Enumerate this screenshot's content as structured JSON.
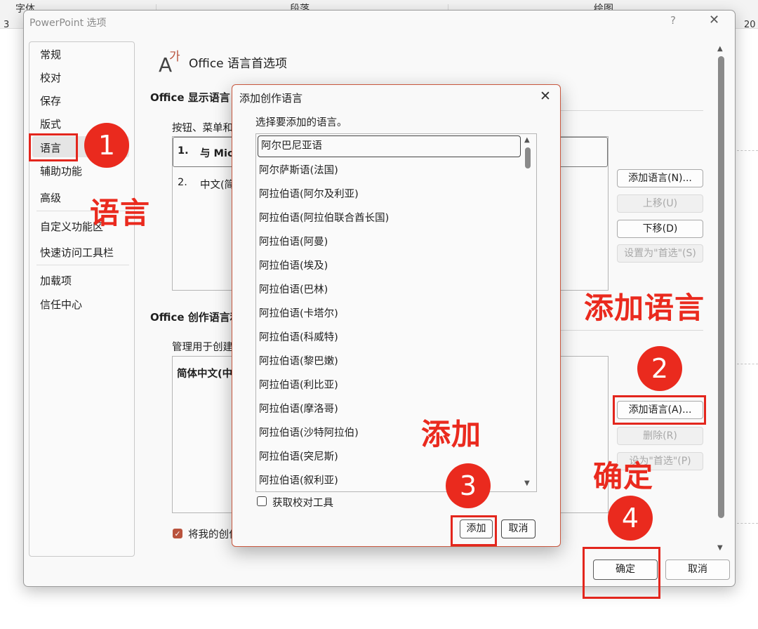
{
  "background": {
    "ribbon_labels": [
      "字体",
      "段落",
      "绘图"
    ],
    "ruler_left": "3",
    "ruler_right": "20"
  },
  "dialog": {
    "title": "PowerPoint 选项",
    "help": "?",
    "close": "✕",
    "sidebar": [
      "常规",
      "校对",
      "保存",
      "版式",
      "语言",
      "辅助功能",
      "高级",
      "自定义功能区",
      "快速访问工具栏",
      "加载项",
      "信任中心"
    ],
    "selected_sidebar": "语言",
    "header_title": "Office 语言首选项",
    "display_section": {
      "title": "Office 显示语言",
      "desc": "按钮、菜单和",
      "items": [
        {
          "num": "1.",
          "text": "与 Mic"
        },
        {
          "num": "2.",
          "text": "中文(简"
        }
      ],
      "buttons": {
        "add": "添加语言(N)...",
        "up": "上移(U)",
        "down": "下移(D)",
        "set_preferred": "设置为\"首选\"(S)"
      }
    },
    "authoring_section": {
      "title": "Office 创作语言和",
      "desc": "管理用于创建",
      "items": [
        "简体中文(中"
      ],
      "buttons": {
        "add": "添加语言(A)...",
        "remove": "删除(R)",
        "set_preferred": "设为\"首选\"(P)"
      },
      "checkbox_label": "将我的创作"
    },
    "ok": "确定",
    "cancel": "取消"
  },
  "popup": {
    "title": "添加创作语言",
    "close": "✕",
    "prompt": "选择要添加的语言。",
    "languages": [
      "阿尔巴尼亚语",
      "阿尔萨斯语(法国)",
      "阿拉伯语(阿尔及利亚)",
      "阿拉伯语(阿拉伯联合酋长国)",
      "阿拉伯语(阿曼)",
      "阿拉伯语(埃及)",
      "阿拉伯语(巴林)",
      "阿拉伯语(卡塔尔)",
      "阿拉伯语(科威特)",
      "阿拉伯语(黎巴嫩)",
      "阿拉伯语(利比亚)",
      "阿拉伯语(摩洛哥)",
      "阿拉伯语(沙特阿拉伯)",
      "阿拉伯语(突尼斯)",
      "阿拉伯语(叙利亚)"
    ],
    "selected_language": "阿尔巴尼亚语",
    "checkbox_label": "获取校对工具",
    "add": "添加",
    "cancel": "取消"
  },
  "annotations": {
    "step1": "1",
    "step2": "2",
    "step3": "3",
    "step4": "4",
    "note_language": "语言",
    "note_add_language": "添加语言",
    "note_add": "添加",
    "note_ok": "确定"
  },
  "colors": {
    "annotation_red": "#ea2a1e",
    "checkbox_accent": "#b9533d",
    "popup_border": "#c8573e"
  }
}
